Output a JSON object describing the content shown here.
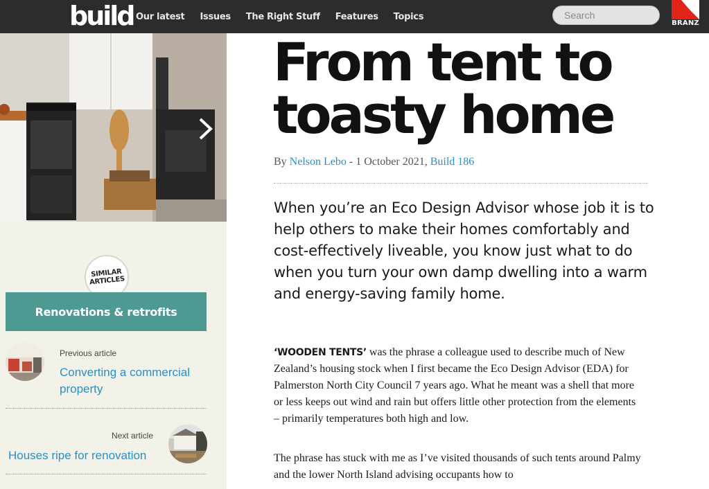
{
  "header": {
    "logo": "build",
    "nav": [
      "Our latest",
      "Issues",
      "The Right Stuff",
      "Features",
      "Topics"
    ],
    "search_placeholder": "Search",
    "brand": "BRANZ",
    "brand_color": "#e2231a"
  },
  "sidebar": {
    "badge_line1": "SIMILAR",
    "badge_line2": "ARTICLES",
    "topic": "Renovations & retrofits",
    "previous_kicker": "Previous article",
    "previous_title": "Converting a commercial property",
    "next_kicker": "Next article",
    "next_title": "Houses ripe for renovation",
    "accent": "#4e9a93",
    "link_color": "#2a8fc2"
  },
  "article": {
    "title": "From tent to toasty home",
    "byline_prefix": "By",
    "author": "Nelson Lebo",
    "date_text": " - 1 October 2021, ",
    "issue": "Build 186",
    "intro": "When you’re an Eco Design Advisor whose job it is to help others to make their homes comfortably and cost-effectively liveable, you know just what to do when you turn your own damp dwelling into a warm and energy-saving family home.",
    "lead_in": "‘WOODEN TENTS’",
    "para1": " was the phrase a colleague used to describe much of New Zealand’s housing stock when I first became the Eco Design Advisor (EDA) for Palmerston North City Council 7 years ago. What he meant was a shell that more or less keeps out wind and rain but offers little other protection from the elements – primarily temperatures both high and low.",
    "para2": "The phrase has stuck with me as I’ve visited thousands of such tents around Palmy and the lower North Island advising occupants how to"
  }
}
